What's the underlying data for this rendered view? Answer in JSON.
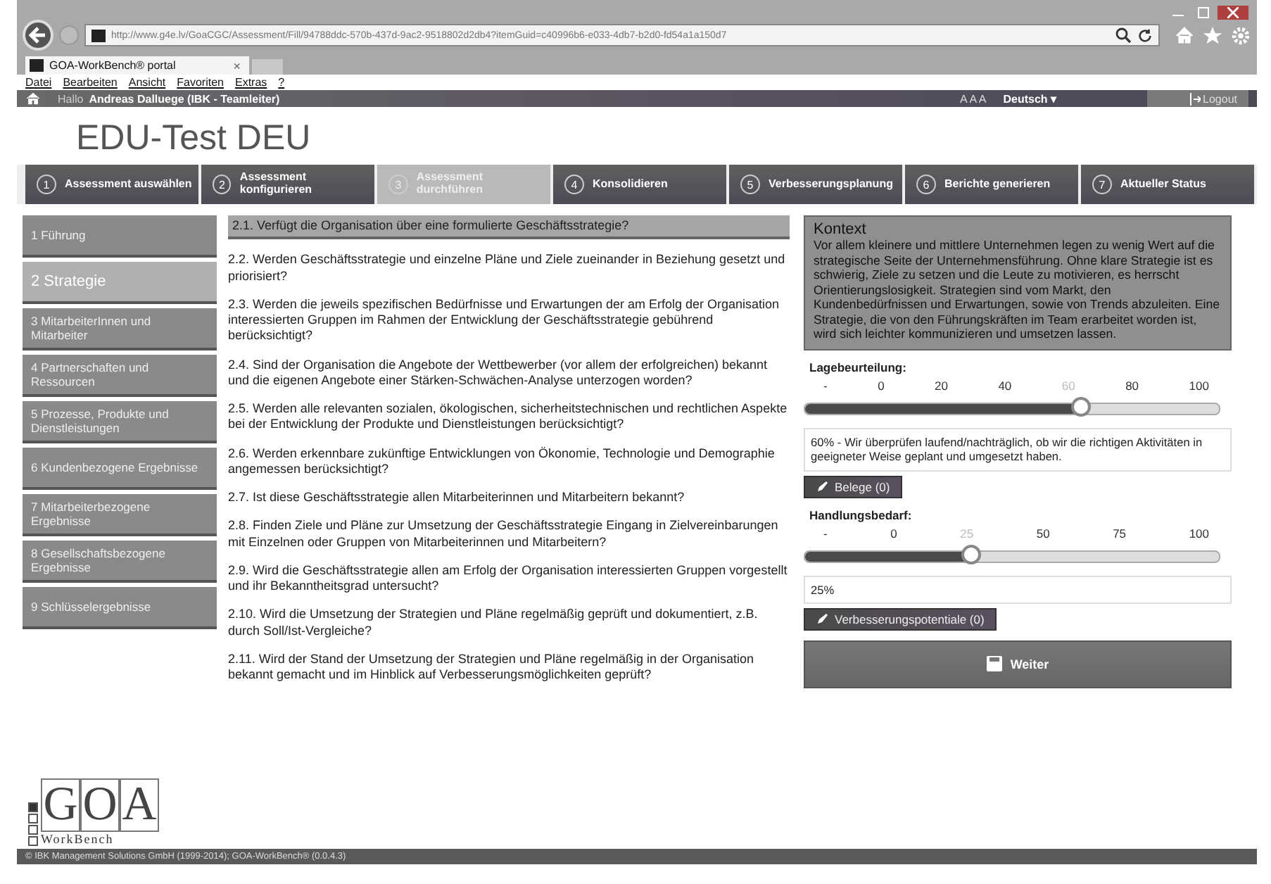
{
  "browser": {
    "url": "http://www.g4e.lv/GoaCGC/Assessment/Fill/94788ddc-570b-437d-9ac2-9518802d2db4?itemGuid=c40996b6-e033-4db7-b2d0-fd54a1a150d7",
    "tab_title": "GOA-WorkBench® portal",
    "tab_close": "×",
    "menu": [
      "Datei",
      "Bearbeiten",
      "Ansicht",
      "Favoriten",
      "Extras",
      "?"
    ]
  },
  "topbar": {
    "greeting": "Hallo",
    "user": "Andreas Dalluege (IBK - Teamleiter)",
    "font_sizes": "A A A",
    "language": "Deutsch ▾",
    "logout": "Logout"
  },
  "page_title": "EDU-Test DEU",
  "steps": [
    {
      "number": "1",
      "label": "Assessment auswählen",
      "selected": false
    },
    {
      "number": "2",
      "label": "Assessment konfigurieren",
      "selected": false
    },
    {
      "number": "3",
      "label": "Assessment durchführen",
      "selected": true
    },
    {
      "number": "4",
      "label": "Konsolidieren",
      "selected": false
    },
    {
      "number": "5",
      "label": "Verbesserungsplanung",
      "selected": false
    },
    {
      "number": "6",
      "label": "Berichte generieren",
      "selected": false
    },
    {
      "number": "7",
      "label": "Aktueller Status",
      "selected": false
    }
  ],
  "sidebar": {
    "items": [
      {
        "label": "1  Führung",
        "selected": false
      },
      {
        "label": "2  Strategie",
        "selected": true
      },
      {
        "label": "3  MitarbeiterInnen und Mitarbeiter",
        "selected": false
      },
      {
        "label": "4  Partnerschaften und Ressourcen",
        "selected": false
      },
      {
        "label": "5  Prozesse, Produkte und Dienstleistungen",
        "selected": false
      },
      {
        "label": "6  Kundenbezogene Ergebnisse",
        "selected": false
      },
      {
        "label": "7  Mitarbeiterbezogene Ergebnisse",
        "selected": false
      },
      {
        "label": "8  Gesellschaftsbezogene Ergebnisse",
        "selected": false
      },
      {
        "label": "9  Schlüsselergebnisse",
        "selected": false
      }
    ]
  },
  "questions": [
    {
      "text": "2.1. Verfügt die Organisation über eine formulierte Geschäftsstrategie?",
      "selected": true
    },
    {
      "text": "2.2. Werden Geschäftsstrategie und einzelne Pläne und Ziele zueinander in Beziehung gesetzt und priorisiert?",
      "selected": false
    },
    {
      "text": "2.3. Werden die jeweils spezifischen Bedürfnisse und Erwartungen der am Erfolg der Organisation interessierten Gruppen im Rahmen der Entwicklung der Geschäftsstrategie gebührend berücksichtigt?",
      "selected": false
    },
    {
      "text": "2.4. Sind der Organisation die Angebote der Wettbewerber (vor allem der erfolgreichen) bekannt und die eigenen Angebote einer Stärken-Schwächen-Analyse unterzogen worden?",
      "selected": false
    },
    {
      "text": "2.5. Werden alle relevanten sozialen, ökologischen, sicherheitstechnischen und rechtlichen Aspekte bei der Entwicklung der Produkte und Dienstleistungen berücksichtigt?",
      "selected": false
    },
    {
      "text": "2.6. Werden erkennbare zukünftige Entwicklungen von Ökonomie, Technologie und Demographie angemessen berücksichtigt?",
      "selected": false
    },
    {
      "text": "2.7. Ist diese Geschäftsstrategie allen Mitarbeiterinnen und Mitarbeitern bekannt?",
      "selected": false
    },
    {
      "text": "2.8. Finden Ziele und Pläne zur Umsetzung der Geschäftsstrategie Eingang in Zielvereinbarungen mit Einzelnen oder Gruppen von Mitarbeiterinnen und Mitarbeitern?",
      "selected": false
    },
    {
      "text": "2.9. Wird die Geschäftsstrategie allen am Erfolg der Organisation interessierten Gruppen vorgestellt und ihr Bekanntheitsgrad untersucht?",
      "selected": false
    },
    {
      "text": "2.10. Wird die Umsetzung der Strategien und Pläne regelmäßig geprüft und dokumentiert, z.B. durch Soll/Ist-Vergleiche?",
      "selected": false
    },
    {
      "text": "2.11. Wird der Stand der Umsetzung der Strategien und Pläne regelmäßig in der Organisation bekannt gemacht und im Hinblick auf Verbesserungsmöglichkeiten geprüft?",
      "selected": false
    }
  ],
  "context": {
    "title": "Kontext",
    "text": "Vor allem kleinere und mittlere Unternehmen legen zu wenig Wert auf die strategische Seite der Unternehmensführung. Ohne klare Strategie ist es schwierig, Ziele zu setzen und die Leute zu motivieren, es herrscht Orientierungslosigkeit. Strategien sind vom Markt, den Kundenbedürfnissen und Erwartungen, sowie von Trends abzuleiten. Eine Strategie, die von den Führungskräften im Team erarbeitet worden ist, wird sich leichter kommunizieren und umsetzen lassen."
  },
  "sliders": [
    {
      "label": "Lagebeurteilung:",
      "ticks": [
        "-",
        "0",
        "20",
        "40",
        "60",
        "80",
        "100"
      ],
      "level": 0.667,
      "reading": "60% - Wir überprüfen laufend/nachträglich, ob wir die richtigen Aktivitäten in geeigneter Weise geplant und umgesetzt haben.",
      "button": "Belege (0)"
    },
    {
      "label": "Handlungsbedarf:",
      "ticks": [
        "-",
        "0",
        "25",
        "50",
        "75",
        "100"
      ],
      "level": 0.4,
      "reading": "25%",
      "button": "Verbesserungspotentiale (0)"
    }
  ],
  "next_button": "Weiter",
  "logo": {
    "letters": "GOA",
    "subtitle": "WorkBench"
  },
  "footer": "© IBK Management Solutions GmbH (1999-2014); GOA-WorkBench® (0.0.4.3)"
}
